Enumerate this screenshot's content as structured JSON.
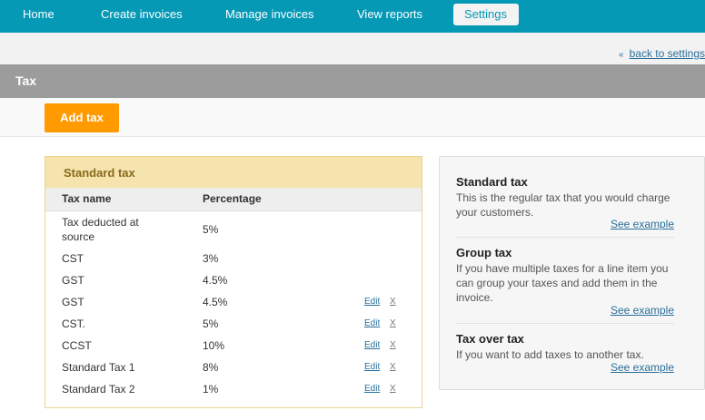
{
  "nav": {
    "items": [
      {
        "label": "Home"
      },
      {
        "label": "Create invoices"
      },
      {
        "label": "Manage invoices"
      },
      {
        "label": "View reports"
      },
      {
        "label": "Settings"
      }
    ],
    "active": "Settings"
  },
  "back_link": "back to settings",
  "header": {
    "title": "Tax"
  },
  "add_button": "Add tax",
  "standard_tax": {
    "title": "Standard tax",
    "columns": {
      "name": "Tax name",
      "percentage": "Percentage"
    },
    "edit_label": "Edit",
    "delete_label": "X",
    "rows": [
      {
        "name": "Tax deducted at source",
        "percentage": "5%"
      },
      {
        "name": "CST",
        "percentage": "3%"
      },
      {
        "name": "GST",
        "percentage": "4.5%"
      },
      {
        "name": "GST",
        "percentage": "4.5%"
      },
      {
        "name": "CST.",
        "percentage": "5%"
      },
      {
        "name": "CCST",
        "percentage": "10%"
      },
      {
        "name": "Standard Tax 1",
        "percentage": "8%"
      },
      {
        "name": "Standard Tax 2",
        "percentage": "1%"
      }
    ]
  },
  "help": {
    "sections": [
      {
        "title": "Standard tax",
        "description": "This is the regular tax that you would charge your customers.",
        "link": "See example"
      },
      {
        "title": "Group tax",
        "description": "If you have multiple taxes for a line item you can group your taxes and add them in the invoice.",
        "link": "See example"
      },
      {
        "title": "Tax over tax",
        "description": "If you want to add taxes to another tax.",
        "link": "See example"
      }
    ]
  },
  "colors": {
    "nav_bg": "#0599b6",
    "header_bg": "#9c9c9c",
    "accent_button": "#ff9a00",
    "panel_head": "#f5e4ae",
    "link": "#2a6f9a"
  }
}
